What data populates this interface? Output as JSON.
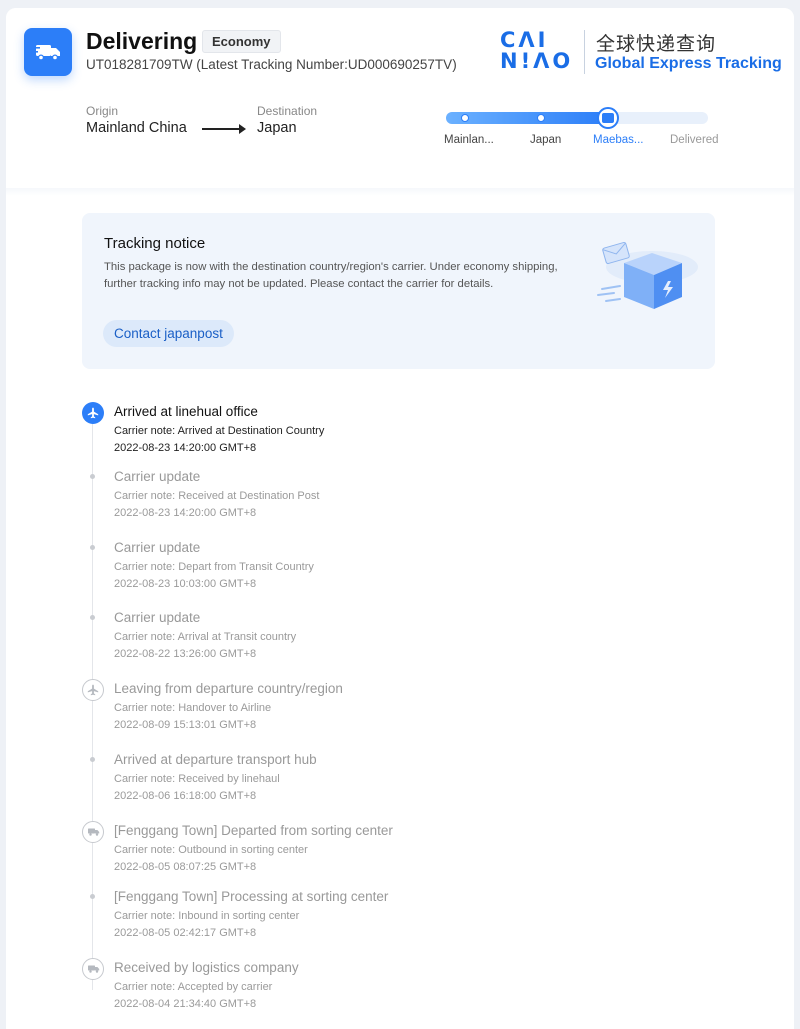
{
  "header": {
    "status": "Delivering",
    "service_level": "Economy",
    "tracking_text": "UT018281709TW  (Latest Tracking Number:UD000690257TV)",
    "status_icon": "truck-icon"
  },
  "brand": {
    "logo_line1": "CΛI",
    "logo_line2": "N!ΛO",
    "name_cn": "全球快递查询",
    "name_en": "Global Express Tracking",
    "accent_color": "#1a6de6"
  },
  "route": {
    "origin_label": "Origin",
    "origin": "Mainland China",
    "destination_label": "Destination",
    "destination": "Japan"
  },
  "progress": {
    "stages": [
      "Mainlan...",
      "Japan",
      "Maebas...",
      "Delivered"
    ],
    "current_index": 2,
    "fill_fraction": 0.62
  },
  "notice": {
    "title": "Tracking notice",
    "body": "This package is now with the destination country/region's carrier. Under economy shipping, further tracking info may not be updated. Please contact the carrier for details.",
    "button": "Contact japanpost"
  },
  "timeline": [
    {
      "title": "Arrived at linehual office",
      "note": "Carrier note: Arrived at Destination Country",
      "time": "2022-08-23 14:20:00 GMT+8",
      "icon": "airplane-icon"
    },
    {
      "title": "Carrier update",
      "note": "Carrier note: Received at Destination Post",
      "time": "2022-08-23 14:20:00 GMT+8",
      "icon": "dot-icon"
    },
    {
      "title": "Carrier update",
      "note": "Carrier note: Depart from Transit Country",
      "time": "2022-08-23 10:03:00 GMT+8",
      "icon": "dot-icon"
    },
    {
      "title": "Carrier update",
      "note": "Carrier note: Arrival at Transit country",
      "time": "2022-08-22 13:26:00 GMT+8",
      "icon": "dot-icon"
    },
    {
      "title": "Leaving from departure country/region",
      "note": "Carrier note: Handover to Airline",
      "time": "2022-08-09 15:13:01 GMT+8",
      "icon": "airplane-icon"
    },
    {
      "title": "Arrived at departure transport hub",
      "note": "Carrier note: Received by linehaul",
      "time": "2022-08-06 16:18:00 GMT+8",
      "icon": "dot-icon"
    },
    {
      "title": "[Fenggang Town] Departed from sorting center",
      "note": "Carrier note: Outbound in sorting center",
      "time": "2022-08-05 08:07:25 GMT+8",
      "icon": "truck-icon"
    },
    {
      "title": "[Fenggang Town] Processing at sorting center",
      "note": "Carrier note: Inbound in sorting center",
      "time": "2022-08-05 02:42:17 GMT+8",
      "icon": "dot-icon"
    },
    {
      "title": "Received by logistics company",
      "note": "Carrier note: Accepted by carrier",
      "time": "2022-08-04 21:34:40 GMT+8",
      "icon": "truck-icon"
    }
  ]
}
